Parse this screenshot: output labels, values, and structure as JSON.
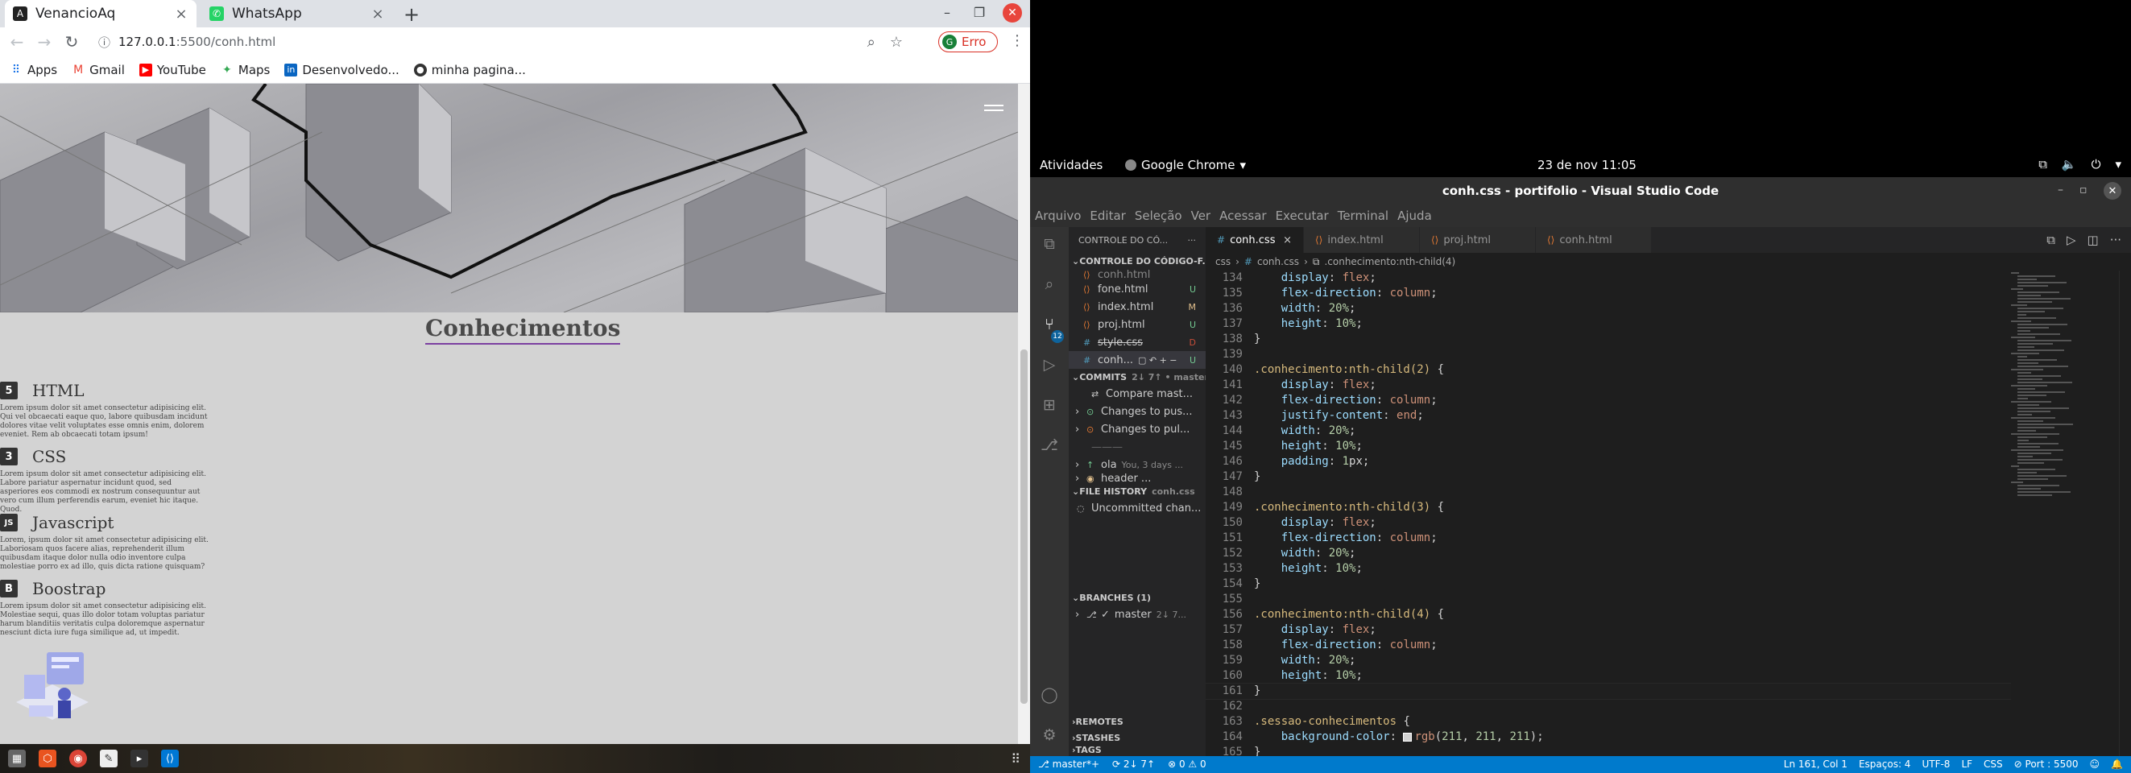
{
  "browser": {
    "tabs": [
      {
        "title": "VenancioAq",
        "icon": "page-favicon",
        "color": "#222222"
      },
      {
        "title": "WhatsApp",
        "icon": "whatsapp-icon",
        "color": "#25d366"
      }
    ],
    "url_host": "127.0.0.1",
    "url_path": ":5500/conh.html",
    "profile_label": "Erro",
    "profile_initial": "G",
    "bookmarks": [
      {
        "label": "Apps",
        "icon": "apps-grid-icon"
      },
      {
        "label": "Gmail",
        "icon": "gmail-icon"
      },
      {
        "label": "YouTube",
        "icon": "youtube-icon"
      },
      {
        "label": "Maps",
        "icon": "maps-icon"
      },
      {
        "label": "Desenvolvedo...",
        "icon": "linkedin-icon"
      },
      {
        "label": "minha pagina...",
        "icon": "github-icon"
      }
    ]
  },
  "webpage": {
    "section_title": "Conhecimentos",
    "skills": [
      {
        "icon_text": "5",
        "name": "HTML",
        "text": "Lorem ipsum dolor sit amet consectetur adipisicing elit. Qui vel obcaecati eaque quo, labore quibusdam incidunt dolores vitae velit voluptates esse omnis enim, dolorem eveniet. Rem ab obcaecati totam ipsum!"
      },
      {
        "icon_text": "3",
        "name": "CSS",
        "text": "Lorem ipsum dolor sit amet consectetur adipisicing elit. Labore pariatur aspernatur incidunt quod, sed asperiores eos commodi ex nostrum consequuntur aut vero cum illum perferendis earum, eveniet hic itaque. Quod."
      },
      {
        "icon_text": "JS",
        "name": "Javascript",
        "text": "Lorem, ipsum dolor sit amet consectetur adipisicing elit. Laboriosam quos facere alias, reprehenderit illum quibusdam itaque dolor nulla odio inventore culpa molestiae porro ex ad illo, quis dicta ratione quisquam?"
      },
      {
        "icon_text": "B",
        "name": "Boostrap",
        "text": "Lorem ipsum dolor sit amet consectetur adipisicing elit. Molestiae sequi, quas illo dolor totam voluptas pariatur harum blanditiis veritatis culpa doloremque aspernatur nesciunt dicta iure fuga similique ad, ut impedit."
      }
    ]
  },
  "taskbar": {
    "items": [
      "files-icon",
      "software-icon",
      "chrome-icon",
      "text-editor-icon",
      "terminal-icon",
      "vscode-icon"
    ]
  },
  "gnome": {
    "activities": "Atividades",
    "app": "Google Chrome",
    "clock": "23 de nov  11:05"
  },
  "vscode": {
    "window_title": "conh.css - portifolio - Visual Studio Code",
    "menu": [
      "Arquivo",
      "Editar",
      "Seleção",
      "Ver",
      "Acessar",
      "Executar",
      "Terminal",
      "Ajuda"
    ],
    "sidebar": {
      "header": "CONTROLE DO CÓ...",
      "section": "CONTROLE DO CÓDIGO-F...",
      "files": [
        {
          "name": "conh.html",
          "status": "",
          "deleted": false
        },
        {
          "name": "fone.html",
          "status": "U",
          "deleted": false
        },
        {
          "name": "index.html",
          "status": "M",
          "deleted": false
        },
        {
          "name": "proj.html",
          "status": "U",
          "deleted": false
        },
        {
          "name": "style.css",
          "status": "D",
          "deleted": true
        },
        {
          "name": "conh...",
          "status": "U",
          "deleted": false
        }
      ],
      "commits_label": "COMMITS",
      "commits_sub": "2↓ 7↑ • master •",
      "commits": [
        "Compare mast...",
        "Changes to pus...",
        "Changes to pul..."
      ],
      "commit_item": "ola",
      "commit_item_sub": "You, 3 days ...",
      "commit_item2": "header ...",
      "file_history_label": "FILE HISTORY",
      "file_history_sub": "conh.css",
      "file_history_item": "Uncommitted chan...",
      "branches_label": "BRANCHES (1)",
      "branch": "master",
      "branch_sub": "2↓ 7...",
      "remotes_label": "REMOTES",
      "stashes_label": "STASHES",
      "tags_label": "TAGS"
    },
    "tabs": [
      {
        "label": "conh.css",
        "kind": "css",
        "active": true
      },
      {
        "label": "index.html",
        "kind": "html",
        "active": false
      },
      {
        "label": "proj.html",
        "kind": "html",
        "active": false
      },
      {
        "label": "conh.html",
        "kind": "html",
        "active": false
      }
    ],
    "breadcrumbs": [
      "css",
      "conh.css",
      ".conhecimento:nth-child(4)"
    ],
    "code_lines": [
      {
        "n": "134",
        "t": "    display: flex;"
      },
      {
        "n": "135",
        "t": "    flex-direction: column;"
      },
      {
        "n": "136",
        "t": "    width: 20%;"
      },
      {
        "n": "137",
        "t": "    height: 10%;"
      },
      {
        "n": "138",
        "t": "}"
      },
      {
        "n": "139",
        "t": ""
      },
      {
        "n": "140",
        "t": ".conhecimento:nth-child(2) {"
      },
      {
        "n": "141",
        "t": "    display: flex;"
      },
      {
        "n": "142",
        "t": "    flex-direction: column;"
      },
      {
        "n": "143",
        "t": "    justify-content: end;"
      },
      {
        "n": "144",
        "t": "    width: 20%;"
      },
      {
        "n": "145",
        "t": "    height: 10%;"
      },
      {
        "n": "146",
        "t": "    padding: 1px;"
      },
      {
        "n": "147",
        "t": "}"
      },
      {
        "n": "148",
        "t": ""
      },
      {
        "n": "149",
        "t": ".conhecimento:nth-child(3) {"
      },
      {
        "n": "150",
        "t": "    display: flex;"
      },
      {
        "n": "151",
        "t": "    flex-direction: column;"
      },
      {
        "n": "152",
        "t": "    width: 20%;"
      },
      {
        "n": "153",
        "t": "    height: 10%;"
      },
      {
        "n": "154",
        "t": "}"
      },
      {
        "n": "155",
        "t": ""
      },
      {
        "n": "156",
        "t": ".conhecimento:nth-child(4) {"
      },
      {
        "n": "157",
        "t": "    display: flex;"
      },
      {
        "n": "158",
        "t": "    flex-direction: column;"
      },
      {
        "n": "159",
        "t": "    width: 20%;"
      },
      {
        "n": "160",
        "t": "    height: 10%;"
      },
      {
        "n": "161",
        "t": "}"
      },
      {
        "n": "162",
        "t": ""
      },
      {
        "n": "163",
        "t": ".sessao-conhecimentos {"
      },
      {
        "n": "164",
        "t": "    background-color: rgb(211, 211, 211);"
      },
      {
        "n": "165",
        "t": "}"
      }
    ],
    "status": {
      "branch": "master*+",
      "sync": "2↓ 7↑",
      "problems": "⊗ 0 ⚠ 0",
      "position": "Ln 161, Col 1",
      "spaces": "Espaços: 4",
      "encoding": "UTF-8",
      "eol": "LF",
      "language": "CSS",
      "port": "Port : 5500"
    }
  }
}
